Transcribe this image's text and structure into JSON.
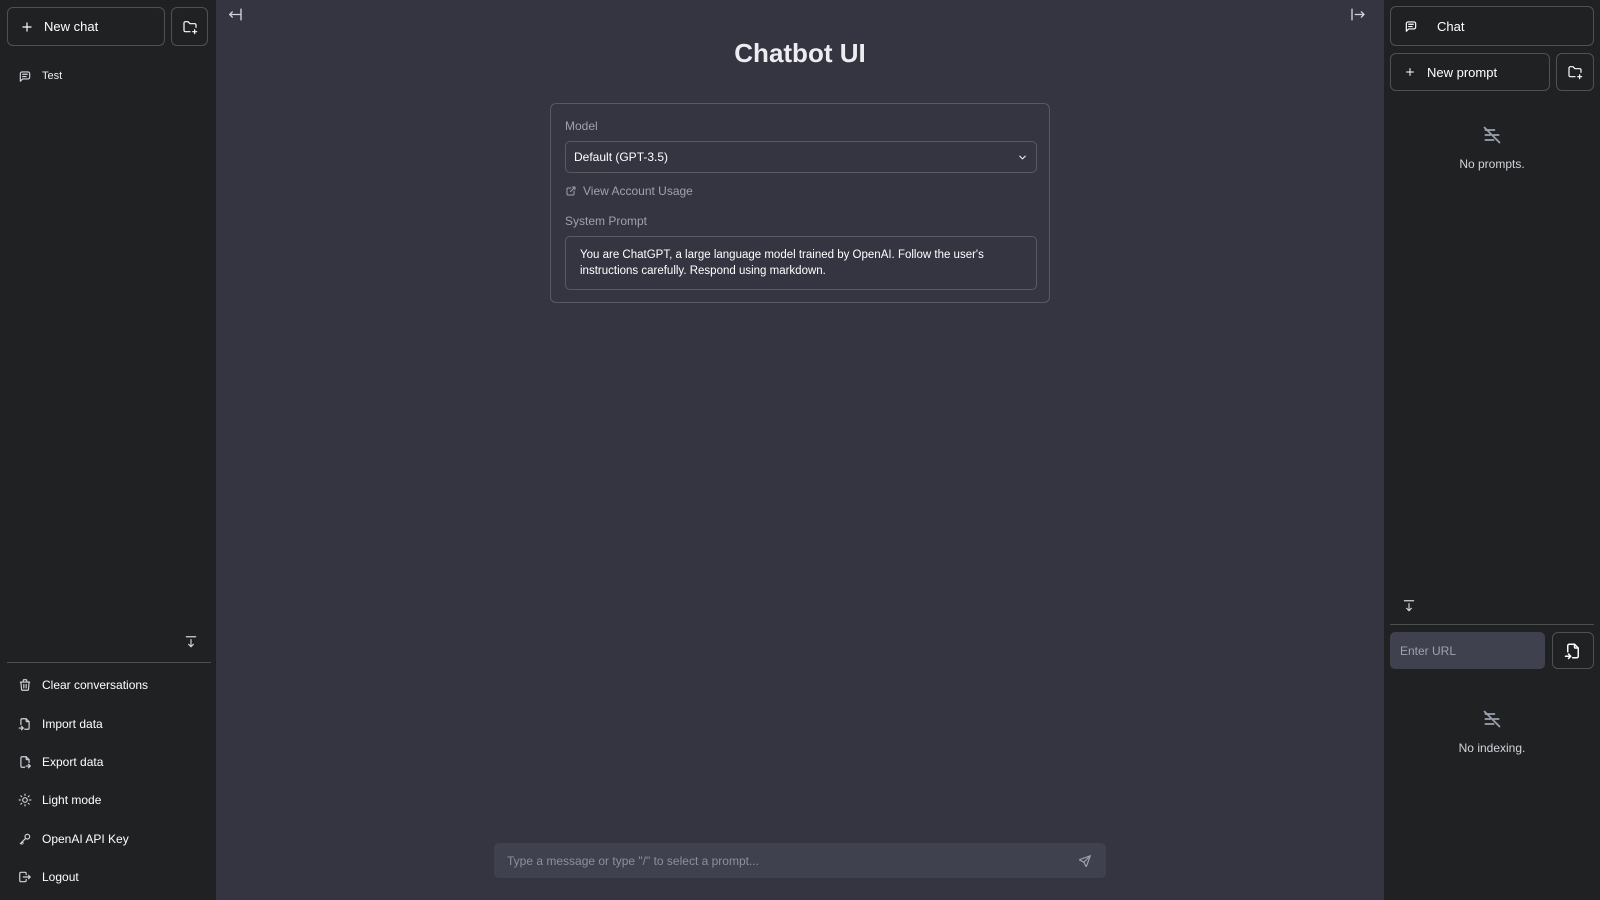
{
  "app": {
    "title": "Chatbot UI"
  },
  "left_sidebar": {
    "new_chat_label": "New chat",
    "new_chat_icon": "plus-icon",
    "new_folder_icon": "folder-plus-icon",
    "conversations": [
      {
        "title": "Test",
        "icon": "message-icon"
      }
    ],
    "menu": [
      {
        "label": "Clear conversations",
        "icon": "trash-icon"
      },
      {
        "label": "Import data",
        "icon": "file-import-icon"
      },
      {
        "label": "Export data",
        "icon": "file-export-icon"
      },
      {
        "label": "Light mode",
        "icon": "sun-icon"
      },
      {
        "label": "OpenAI API Key",
        "icon": "key-icon"
      },
      {
        "label": "Logout",
        "icon": "logout-icon"
      }
    ]
  },
  "settings": {
    "model_label": "Model",
    "model_selected": "Default (GPT-3.5)",
    "usage_link": "View Account Usage",
    "system_prompt_label": "System Prompt",
    "system_prompt": "You are ChatGPT, a large language model trained by OpenAI. Follow the user's instructions carefully. Respond using markdown."
  },
  "chat_input": {
    "placeholder": "Type a message or type \"/\" to select a prompt..."
  },
  "right_sidebar": {
    "chat_label": "Chat",
    "new_prompt_label": "New prompt",
    "no_prompts": "No prompts.",
    "url_placeholder": "Enter URL",
    "no_indexing": "No indexing."
  },
  "colors": {
    "sidebar_bg": "#202123",
    "main_bg": "#343541",
    "input_bg": "#40414f",
    "text": "#ececf1",
    "muted_text": "#a1a1aa"
  }
}
